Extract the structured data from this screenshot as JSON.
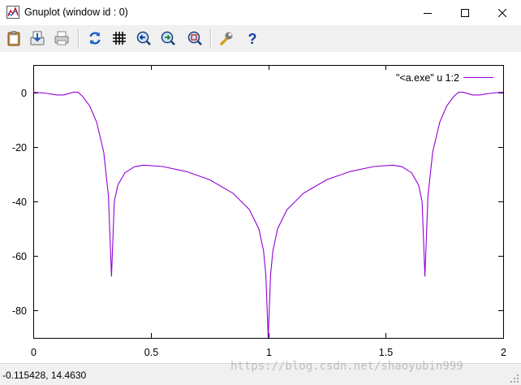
{
  "window": {
    "title": "Gnuplot (window id : 0)"
  },
  "toolbar": {
    "buttons": [
      {
        "name": "copy-clipboard",
        "icon": "clipboard-icon"
      },
      {
        "name": "save-image",
        "icon": "save-icon"
      },
      {
        "name": "print",
        "icon": "printer-icon"
      },
      {
        "name": "replot",
        "icon": "refresh-icon"
      },
      {
        "name": "toggle-grid",
        "icon": "grid-icon"
      },
      {
        "name": "previous-zoom",
        "icon": "zoom-back-icon"
      },
      {
        "name": "next-zoom",
        "icon": "zoom-forward-icon"
      },
      {
        "name": "autoscale",
        "icon": "zoom-fit-icon"
      },
      {
        "name": "options",
        "icon": "wrench-icon"
      },
      {
        "name": "help",
        "icon": "help-icon"
      }
    ]
  },
  "status": {
    "coordinates": "-0.115428,  14.4630"
  },
  "watermark": "https://blog.csdn.net/shaoyubin999",
  "colors": {
    "series": "#9400d3",
    "toolbar": "#f0f0f0"
  },
  "chart_data": {
    "type": "line",
    "xlim": [
      0,
      2
    ],
    "ylim": [
      -90,
      10
    ],
    "x_ticks": [
      "0",
      "0.5",
      "1",
      "1.5",
      "2"
    ],
    "y_ticks": [
      "0",
      "-20",
      "-40",
      "-60",
      "-80"
    ],
    "grid": false,
    "legend": "top-right",
    "series": [
      {
        "name": "\"<a.exe\" u 1:2",
        "color": "#9400d3",
        "points": [
          [
            0,
            0
          ],
          [
            0.05,
            -0.3
          ],
          [
            0.1,
            -1
          ],
          [
            0.13,
            -1
          ],
          [
            0.17,
            0
          ],
          [
            0.19,
            0
          ],
          [
            0.21,
            -1.5
          ],
          [
            0.24,
            -5
          ],
          [
            0.27,
            -11
          ],
          [
            0.3,
            -22
          ],
          [
            0.32,
            -38
          ],
          [
            0.333,
            -67.5
          ],
          [
            0.345,
            -40
          ],
          [
            0.36,
            -34
          ],
          [
            0.39,
            -29.5
          ],
          [
            0.43,
            -27.3
          ],
          [
            0.47,
            -26.7
          ],
          [
            0.55,
            -27.2
          ],
          [
            0.65,
            -29
          ],
          [
            0.75,
            -32
          ],
          [
            0.85,
            -37
          ],
          [
            0.92,
            -43
          ],
          [
            0.96,
            -50
          ],
          [
            0.98,
            -58
          ],
          [
            0.99,
            -67
          ],
          [
            1,
            -90
          ],
          [
            1.01,
            -67
          ],
          [
            1.02,
            -58
          ],
          [
            1.04,
            -50
          ],
          [
            1.08,
            -43
          ],
          [
            1.15,
            -37
          ],
          [
            1.25,
            -32
          ],
          [
            1.35,
            -29
          ],
          [
            1.45,
            -27.2
          ],
          [
            1.53,
            -26.7
          ],
          [
            1.57,
            -27.3
          ],
          [
            1.61,
            -29.5
          ],
          [
            1.64,
            -34
          ],
          [
            1.655,
            -40
          ],
          [
            1.667,
            -67.5
          ],
          [
            1.68,
            -38
          ],
          [
            1.7,
            -22
          ],
          [
            1.73,
            -11
          ],
          [
            1.76,
            -5
          ],
          [
            1.79,
            -1.5
          ],
          [
            1.81,
            0
          ],
          [
            1.83,
            0
          ],
          [
            1.87,
            -1
          ],
          [
            1.9,
            -1
          ],
          [
            1.95,
            -0.3
          ],
          [
            2,
            0
          ]
        ]
      }
    ]
  }
}
